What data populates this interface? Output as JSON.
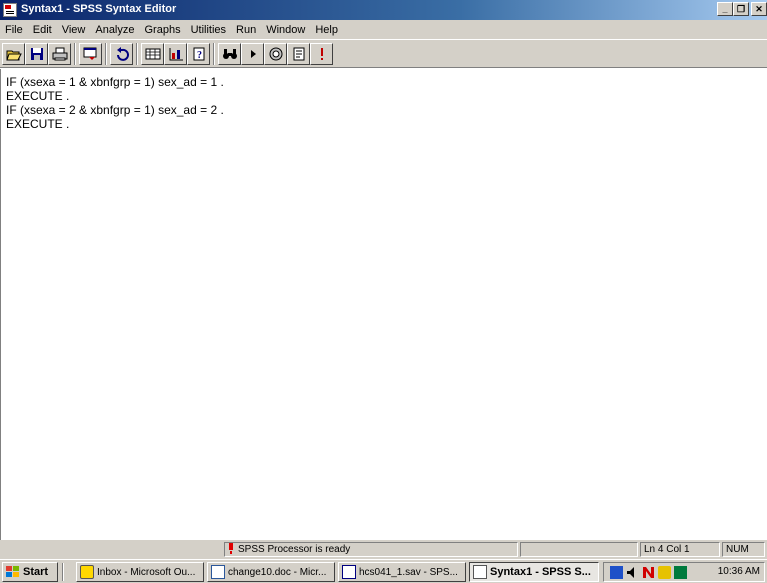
{
  "window": {
    "title": "Syntax1 - SPSS Syntax Editor"
  },
  "window_controls": {
    "minimize": "_",
    "maximize": "❐",
    "close": "✕"
  },
  "menu": [
    "File",
    "Edit",
    "View",
    "Analyze",
    "Graphs",
    "Utilities",
    "Run",
    "Window",
    "Help"
  ],
  "toolbar_icons": [
    "open-icon",
    "save-icon",
    "print-icon",
    "dialog-recall-icon",
    "undo-icon",
    "goto-data-icon",
    "goto-chart-icon",
    "variables-icon",
    "find-icon",
    "run-icon",
    "syntax-help-icon",
    "use-sets-icon",
    "designate-window-icon"
  ],
  "editor": {
    "lines": [
      "IF (xsexa = 1 & xbnfgrp = 1) sex_ad = 1 .",
      "EXECUTE .",
      "IF (xsexa = 2 & xbnfgrp = 1) sex_ad = 2 .",
      "EXECUTE ."
    ]
  },
  "status": {
    "processor": "SPSS Processor  is ready",
    "position": "Ln 4 Col 1",
    "num": "NUM"
  },
  "taskbar": {
    "start": "Start",
    "tasks": [
      "Inbox - Microsoft Ou...",
      "change10.doc - Micr...",
      "hcs041_1.sav - SPS...",
      "Syntax1 - SPSS S..."
    ],
    "clock": "10:36 AM"
  }
}
